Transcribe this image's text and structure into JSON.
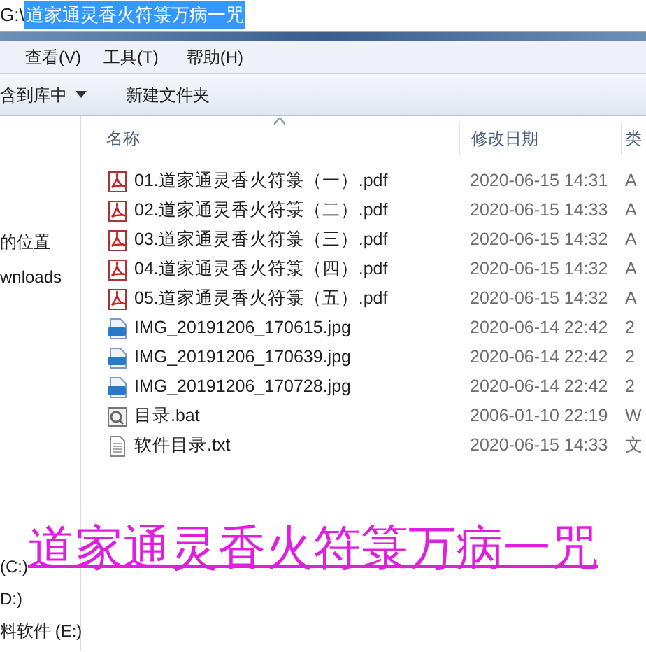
{
  "address_bar": {
    "prefix": "G:\\",
    "path": "道家通灵香火符箓万病一咒",
    "selected": true
  },
  "menu": [
    "查看(V)",
    "工具(T)",
    "帮助(H)"
  ],
  "toolbar": [
    {
      "label": "含到库中",
      "dropdown": true
    },
    {
      "label": "新建文件夹",
      "dropdown": false
    }
  ],
  "sidebar": {
    "favorites": [
      "的位置",
      "wnloads"
    ],
    "drives": [
      "(C:)",
      "D:)",
      "料软件 (E:)"
    ]
  },
  "table": {
    "columns": [
      "名称",
      "修改日期",
      "类"
    ],
    "rows": [
      {
        "kind": "pdf",
        "name": "01.道家通灵香火符箓（一）.pdf",
        "date": "2020-06-15 14:31",
        "column_3": "A"
      },
      {
        "kind": "pdf",
        "name": "02.道家通灵香火符箓（二）.pdf",
        "date": "2020-06-15 14:33",
        "column_3": "A"
      },
      {
        "kind": "pdf",
        "name": "03.道家通灵香火符箓（三）.pdf",
        "date": "2020-06-15 14:32",
        "column_3": "A"
      },
      {
        "kind": "pdf",
        "name": "04.道家通灵香火符箓（四）.pdf",
        "date": "2020-06-15 14:32",
        "column_3": "A"
      },
      {
        "kind": "pdf",
        "name": "05.道家通灵香火符箓（五）.pdf",
        "date": "2020-06-15 14:32",
        "column_3": "A"
      },
      {
        "kind": "jpg",
        "name": "IMG_20191206_170615.jpg",
        "date": "2020-06-14 22:42",
        "column_3": "2"
      },
      {
        "kind": "jpg",
        "name": "IMG_20191206_170639.jpg",
        "date": "2020-06-14 22:42",
        "column_3": "2"
      },
      {
        "kind": "jpg",
        "name": "IMG_20191206_170728.jpg",
        "date": "2020-06-14 22:42",
        "column_3": "2"
      },
      {
        "kind": "bat",
        "name": "目录.bat",
        "date": "2006-01-10 22:19",
        "column_3": "W"
      },
      {
        "kind": "txt",
        "name": "软件目录.txt",
        "date": "2020-06-15 14:33",
        "column_3": "文"
      }
    ]
  },
  "caption": "道家通灵香火符箓万病一咒"
}
